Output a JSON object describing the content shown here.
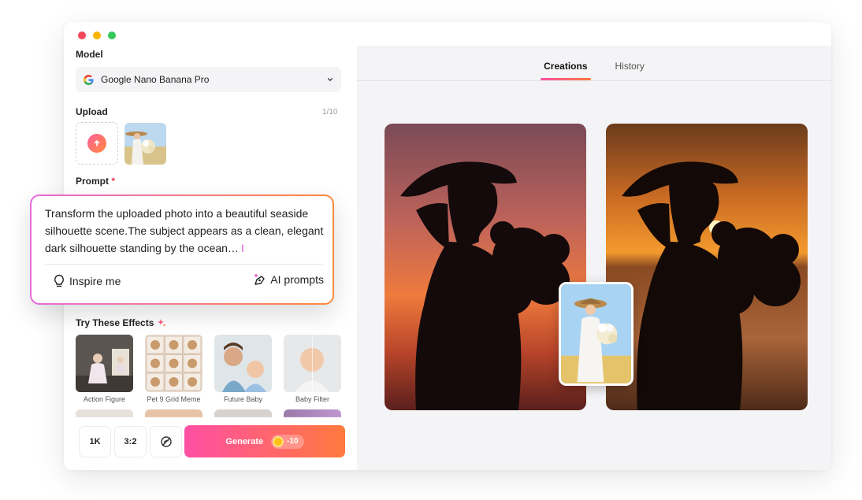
{
  "window": {
    "controls": [
      "close",
      "minimize",
      "maximize"
    ]
  },
  "model": {
    "label": "Model",
    "selected": "Google Nano Banana Pro",
    "icon": "google-icon"
  },
  "upload": {
    "label": "Upload",
    "count": "1/10"
  },
  "prompt": {
    "label": "Prompt",
    "required_mark": "*",
    "text": "Transform the uploaded photo into a beautiful seaside silhouette scene.The subject appears as a clean, elegant dark silhouette standing by the ocean…",
    "inspire_label": "Inspire me",
    "ai_prompts_label": "AI prompts"
  },
  "effects": {
    "title": "Try These Effects",
    "items": [
      {
        "name": "Action Figure"
      },
      {
        "name": "Pet 9 Grid Meme"
      },
      {
        "name": "Future Baby"
      },
      {
        "name": "Baby Filter"
      }
    ]
  },
  "toolbar": {
    "resolution": "1K",
    "aspect": "3:2",
    "generate_label": "Generate",
    "credit_cost": "-10"
  },
  "tabs": [
    {
      "label": "Creations",
      "active": true
    },
    {
      "label": "History",
      "active": false
    }
  ],
  "colors": {
    "accent_start": "#ff4fa3",
    "accent_end": "#ff7a3d",
    "panel_bg": "#f4f4f6"
  }
}
